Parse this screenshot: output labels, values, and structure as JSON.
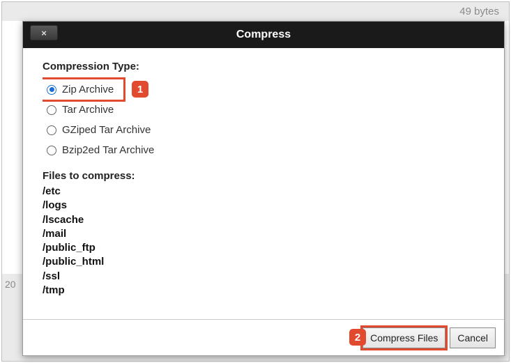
{
  "background": {
    "bytes_text": "49 bytes",
    "left_number": "20"
  },
  "dialog": {
    "title": "Compress",
    "close_glyph": "×",
    "section_type_label": "Compression Type:",
    "options": [
      {
        "label": "Zip Archive",
        "checked": true
      },
      {
        "label": "Tar Archive",
        "checked": false
      },
      {
        "label": "GZiped Tar Archive",
        "checked": false
      },
      {
        "label": "Bzip2ed Tar Archive",
        "checked": false
      }
    ],
    "files_label": "Files to compress:",
    "files": [
      "/etc",
      "/logs",
      "/lscache",
      "/mail",
      "/public_ftp",
      "/public_html",
      "/ssl",
      "/tmp"
    ],
    "buttons": {
      "compress": "Compress Files",
      "cancel": "Cancel"
    }
  },
  "annotations": {
    "badge1": "1",
    "badge2": "2"
  }
}
